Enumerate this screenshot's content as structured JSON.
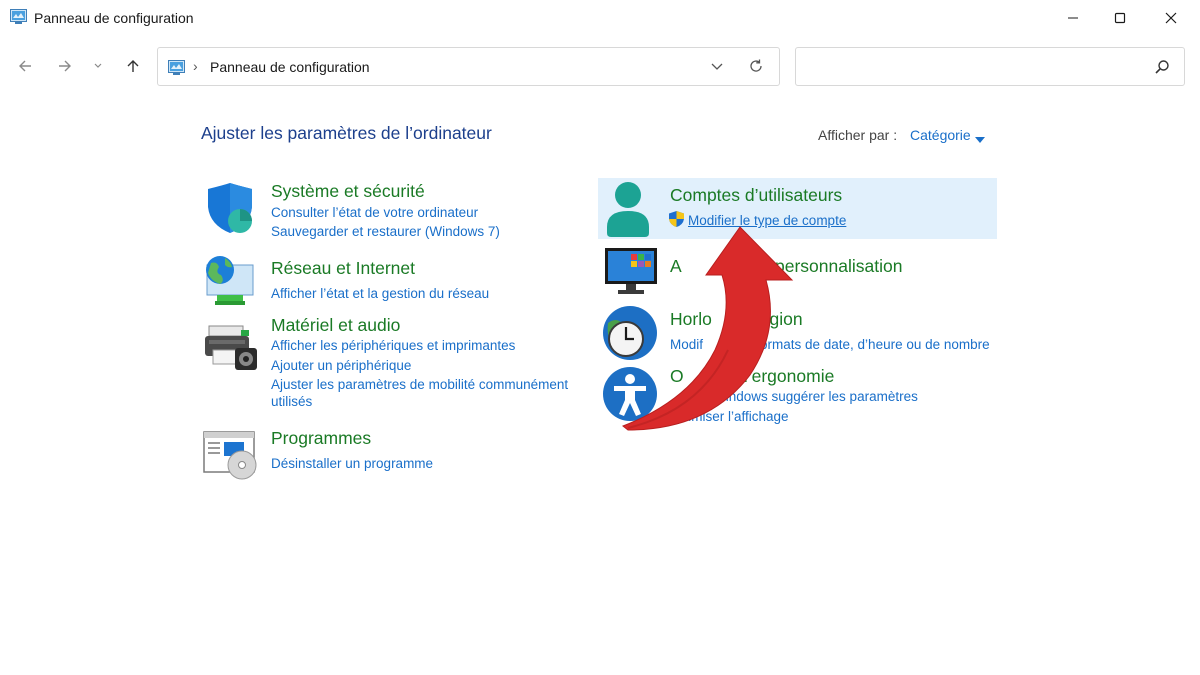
{
  "window": {
    "title": "Panneau de configuration",
    "icon": "control-panel-icon"
  },
  "address_bar": {
    "path": "Panneau de configuration"
  },
  "search": {
    "placeholder": ""
  },
  "main": {
    "title": "Ajuster les paramètres de l’ordinateur",
    "view_by_label": "Afficher par :",
    "view_by_value": "Catégorie"
  },
  "categories": {
    "systeme": {
      "title": "Système et sécurité",
      "icon": "shield-icon",
      "links": [
        "Consulter l’état de votre ordinateur",
        "Sauvegarder et restaurer (Windows 7)"
      ]
    },
    "reseau": {
      "title": "Réseau et Internet",
      "icon": "network-globe-icon",
      "links": [
        "Afficher l’état et la gestion du réseau"
      ]
    },
    "materiel": {
      "title": "Matériel et audio",
      "icon": "printer-icon",
      "links": [
        "Afficher les périphériques et imprimantes",
        "Ajouter un périphérique",
        "Ajuster les paramètres de mobilité communément",
        "utilisés"
      ]
    },
    "programmes": {
      "title": "Programmes",
      "icon": "programs-disc-icon",
      "links": [
        "Désinstaller un programme"
      ]
    },
    "comptes": {
      "title": "Comptes d’utilisateurs",
      "icon": "user-icon",
      "links": [
        "Modifier le type de compte"
      ]
    },
    "apparence": {
      "title": "Apparence et personnalisation",
      "icon": "monitor-icon",
      "title_visible_left": "A",
      "title_visible_right": "personnalisation"
    },
    "horloge": {
      "title_visible_left": "Horlo",
      "title_visible_right": "région",
      "icon": "clock-globe-icon",
      "link_visible_left": "Modif",
      "link_visible_right": "ormats de date, d’heure ou de nombre"
    },
    "ergonomie": {
      "title_visible_left": "O",
      "title_visible_right": "d’ergonomie",
      "icon": "accessibility-icon",
      "link1_visible": "Windows suggérer les paramètres",
      "link2_visible": "ptimiser l’affichage"
    }
  },
  "colors": {
    "category_title": "#1a7a25",
    "link": "#1a6fc9",
    "page_title": "#1c3f8c",
    "highlight": "#e1f0fc",
    "arrow": "#d92a2a"
  }
}
